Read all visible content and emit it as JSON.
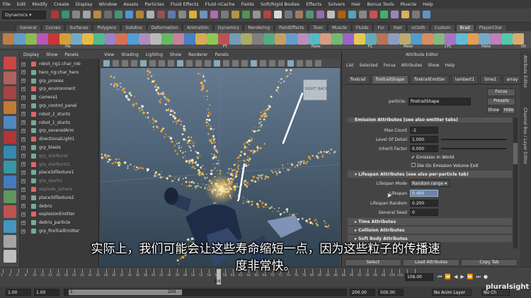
{
  "menubar": {
    "items": [
      "File",
      "Edit",
      "Modify",
      "Create",
      "Display",
      "Window",
      "Assets",
      "Particles",
      "Fluid Effects",
      "Fluid nCache",
      "Fields",
      "Soft/Rigid Bodies",
      "Effects",
      "Solvers",
      "Hair",
      "Bonus Tools",
      "Muscle",
      "Help"
    ]
  },
  "status": {
    "mode": "Dynamics"
  },
  "shelf": {
    "tabs": [
      "General",
      "Curves",
      "Surfaces",
      "Polygons",
      "Subdivs",
      "Deformation",
      "Animation",
      "Dynamics",
      "Rendering",
      "PaintEffects",
      "Toon",
      "Muscle",
      "Fluids",
      "Fur",
      "Hair",
      "nCloth",
      "Custom",
      "Brad",
      "PlayerChar"
    ],
    "active_tab": "Brad",
    "icon_labels": [
      "His",
      "FT",
      "Parer",
      "FC",
      "Mesh",
      "CFC",
      "Hshd",
      "UV"
    ]
  },
  "outliner": {
    "menu": [
      "Display",
      "Show",
      "Panels"
    ],
    "items": [
      "robot_rig1:char_rob",
      "hero_rig:char_hero",
      "grp_proxies",
      "grp_environment",
      "camera1",
      "grp_control_panel",
      "robot_2_stunts",
      "robot_1_stunts",
      "grp_severedArm",
      "directionalLight1",
      "grp_blasts",
      "grp_starBurst",
      "grp_starBurst1",
      "place3dTexture1",
      "grp_sparks",
      "explode_sphere",
      "place3dTexture2",
      "debris",
      "explosionEmitter",
      "debris_particle",
      "grp_fireTrailEmitter"
    ]
  },
  "viewport": {
    "menu": [
      "View",
      "Shading",
      "Lighting",
      "Show",
      "Renderer",
      "Panels"
    ],
    "viewcube": {
      "left": "RIGHT",
      "right": "BACK"
    }
  },
  "attribute_editor": {
    "title": "Attribute Editor",
    "menu": [
      "List",
      "Selected",
      "Focus",
      "Attributes",
      "Show",
      "Help"
    ],
    "tabs": [
      "firetrail",
      "firetrailShape",
      "firetrailEmitter",
      "lambert1",
      "time1",
      "array"
    ],
    "active_tab": "firetrailShape",
    "particle_label": "particle:",
    "particle_value": "firetrailShape",
    "focus": "Focus",
    "presets": "Presets",
    "show": "Show",
    "hide": "Hide",
    "section_cut": "Emission Attributes (see also emitter tabs)",
    "rows": [
      {
        "label": "Max Count",
        "value": "-1"
      },
      {
        "label": "Level Of Detail",
        "value": "1.000"
      },
      {
        "label": "Inherit Factor",
        "value": "0.000"
      }
    ],
    "check1": "Emission In World",
    "check2": "Die On Emission Volume Exit",
    "lifespan_section": "Lifespan Attributes (see also per-particle tab)",
    "lifespan_mode_label": "Lifespan Mode",
    "lifespan_mode": "Random range",
    "lifespan_label": "Lifespan",
    "lifespan": "0.400",
    "lifespan_random_label": "Lifespan Random",
    "lifespan_random": "0.200",
    "general_seed_label": "General Seed",
    "general_seed": "0",
    "time_section": "Time Attributes",
    "collision_section": "Collision Attributes",
    "soft_section": "Soft Body Attributes",
    "select": "Select",
    "load": "Load Attributes",
    "copy": "Copy Tab"
  },
  "right_sidebar": {
    "labels": [
      "Attribute Editor",
      "Channel Box / Layer Editor"
    ]
  },
  "timeline": {
    "current_frame": "106.00",
    "current_mark": "106",
    "ticks": [
      "2",
      "4",
      "6",
      "8",
      "10",
      "12",
      "14",
      "16",
      "18",
      "20",
      "22",
      "24",
      "26",
      "28",
      "30",
      "32",
      "34",
      "36",
      "38",
      "40",
      "42",
      "44",
      "46",
      "48",
      "50",
      "52",
      "54",
      "56",
      "58",
      "60",
      "62",
      "64",
      "66",
      "68",
      "70",
      "72",
      "74",
      "76",
      "78",
      "80",
      "82",
      "84",
      "86",
      "88",
      "90",
      "92",
      "94",
      "96",
      "98",
      "100",
      "102",
      "104",
      "106"
    ]
  },
  "range": {
    "start": "1.00",
    "inner_start": "1.00",
    "left_num": "1",
    "slider_end": "200",
    "end": "200.00",
    "outer_end": "500.00",
    "anim_layer": "No Anim Layer",
    "char_set": "No Ch"
  },
  "watermark": "pluralsight",
  "subtitle": {
    "line1": "实际上，我们可能会让这些寿命缩短一点，因为这些粒子的传播速",
    "line2": "度非常快。"
  }
}
